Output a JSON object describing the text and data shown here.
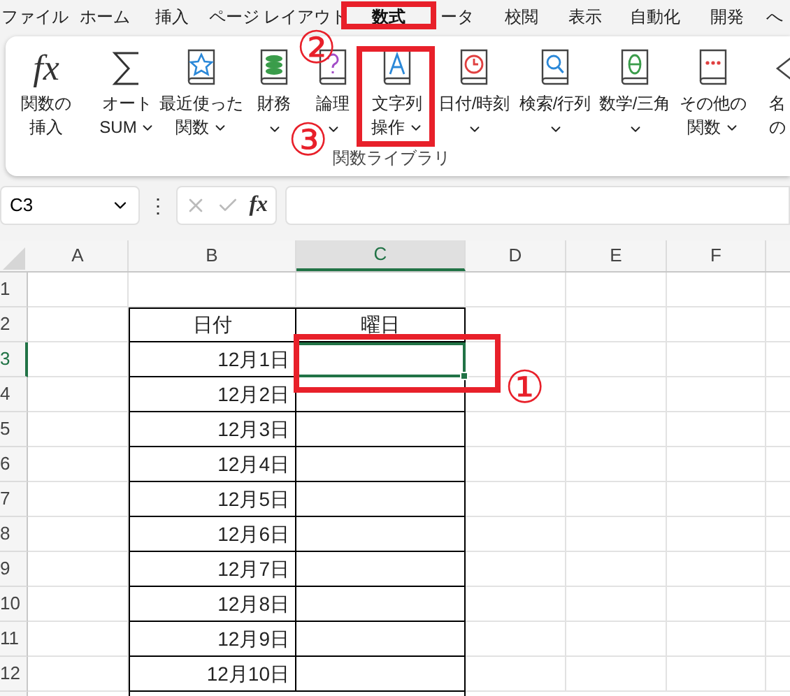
{
  "menu_tabs": [
    {
      "label": "ファイル",
      "selected": false
    },
    {
      "label": "ホーム",
      "selected": false
    },
    {
      "label": "挿入",
      "selected": false
    },
    {
      "label": "ページ レイアウト",
      "selected": false
    },
    {
      "label": "数式",
      "selected": true
    },
    {
      "label": "ータ",
      "selected": false
    },
    {
      "label": "校閲",
      "selected": false
    },
    {
      "label": "表示",
      "selected": false
    },
    {
      "label": "自動化",
      "selected": false
    },
    {
      "label": "開発",
      "selected": false
    },
    {
      "label": "へ",
      "selected": false
    }
  ],
  "ribbon": {
    "buttons": [
      {
        "glyph": "fx",
        "lines": [
          "関数の",
          "挿入"
        ],
        "dropdown": false
      },
      {
        "lines": [
          "オート",
          "SUM"
        ],
        "dropdown": true
      },
      {
        "lines": [
          "最近使った",
          "関数"
        ],
        "dropdown": true
      },
      {
        "lines": [
          "財務"
        ],
        "dropdown": true
      },
      {
        "lines": [
          "論理"
        ],
        "dropdown": true
      },
      {
        "lines": [
          "文字列",
          "操作"
        ],
        "dropdown": true
      },
      {
        "lines": [
          "日付/時刻"
        ],
        "dropdown": true
      },
      {
        "lines": [
          "検索/行列"
        ],
        "dropdown": true
      },
      {
        "lines": [
          "数学/三角"
        ],
        "dropdown": true
      },
      {
        "lines": [
          "その他の",
          "関数"
        ],
        "dropdown": true
      },
      {
        "lines": [
          "名",
          "の"
        ]
      }
    ],
    "group_label": "関数ライブラリ"
  },
  "formula_bar": {
    "name_box": "C3",
    "menu_glyph": "⋮",
    "function_glyph": "fx"
  },
  "columns": [
    {
      "label": "A",
      "selected": false
    },
    {
      "label": "B",
      "selected": false
    },
    {
      "label": "C",
      "selected": true
    },
    {
      "label": "D",
      "selected": false
    },
    {
      "label": "E",
      "selected": false
    },
    {
      "label": "F",
      "selected": false
    }
  ],
  "rows": [
    {
      "label": "1",
      "selected": false,
      "kind": "blank"
    },
    {
      "label": "2",
      "selected": false,
      "kind": "header",
      "b": "日付",
      "c": "曜日"
    },
    {
      "label": "3",
      "selected": true,
      "kind": "data",
      "b": "12月1日"
    },
    {
      "label": "4",
      "selected": false,
      "kind": "data",
      "b": "12月2日"
    },
    {
      "label": "5",
      "selected": false,
      "kind": "data",
      "b": "12月3日"
    },
    {
      "label": "6",
      "selected": false,
      "kind": "data",
      "b": "12月4日"
    },
    {
      "label": "7",
      "selected": false,
      "kind": "data",
      "b": "12月5日"
    },
    {
      "label": "8",
      "selected": false,
      "kind": "data",
      "b": "12月6日"
    },
    {
      "label": "9",
      "selected": false,
      "kind": "data",
      "b": "12月7日"
    },
    {
      "label": "10",
      "selected": false,
      "kind": "data",
      "b": "12月8日"
    },
    {
      "label": "11",
      "selected": false,
      "kind": "data",
      "b": "12月9日"
    },
    {
      "label": "12",
      "selected": false,
      "kind": "data",
      "b": "12月10日"
    }
  ],
  "annotations": [
    {
      "label": "②"
    },
    {
      "label": "③"
    },
    {
      "label": "①"
    }
  ]
}
